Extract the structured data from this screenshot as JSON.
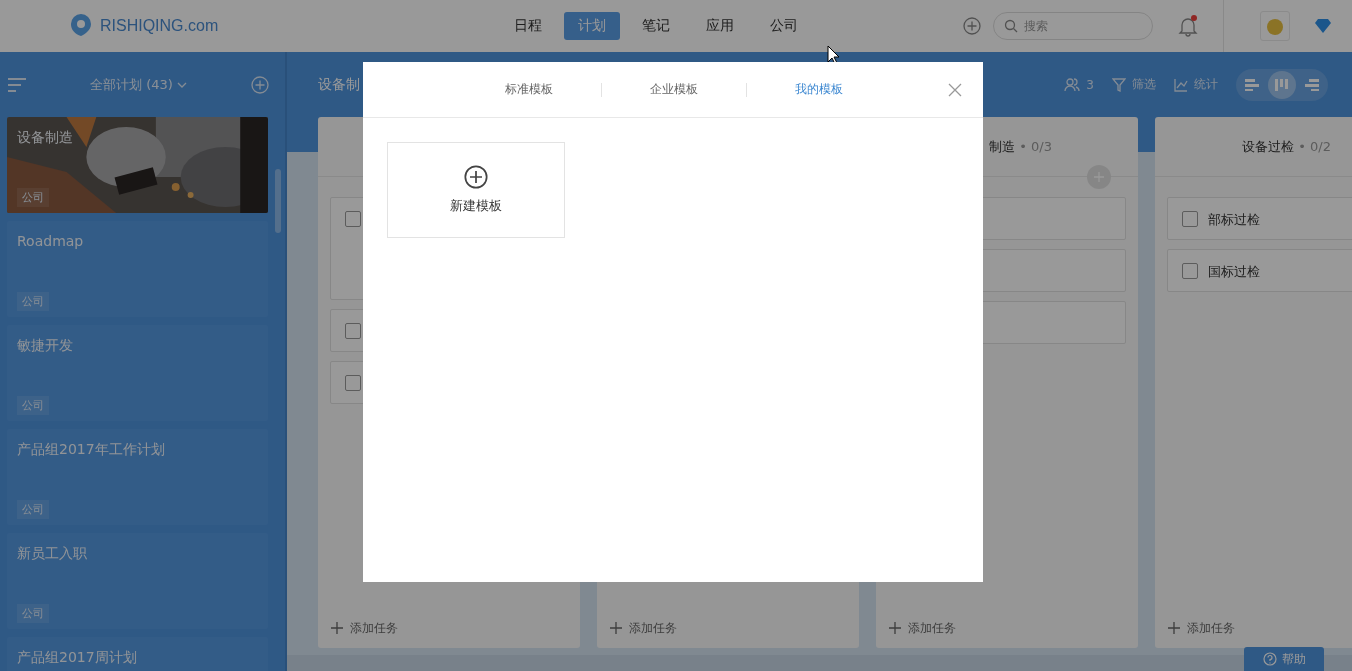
{
  "header": {
    "logo": "RISHIQING.com",
    "nav": [
      {
        "label": "日程",
        "selected": false
      },
      {
        "label": "计划",
        "selected": true
      },
      {
        "label": "笔记",
        "selected": false
      },
      {
        "label": "应用",
        "selected": false
      },
      {
        "label": "公司",
        "selected": false
      }
    ],
    "search": {
      "placeholder": "搜索"
    },
    "notifications": {
      "unread": true
    }
  },
  "sidebar": {
    "title": "全部计划 (43)",
    "plans": [
      {
        "kind": "picture",
        "title": "设备制造",
        "tag": "公司"
      },
      {
        "kind": "plain",
        "title": "Roadmap",
        "tag": "公司"
      },
      {
        "kind": "plain",
        "title": "敏捷开发",
        "tag": "公司"
      },
      {
        "kind": "plain",
        "title": "产品组2017年工作计划",
        "tag": "公司"
      },
      {
        "kind": "plain",
        "title": "新员工入职",
        "tag": "公司"
      },
      {
        "kind": "plain",
        "title": "产品组2017周计划"
      }
    ]
  },
  "board": {
    "title": "设备制",
    "members": "3",
    "filter": "筛选",
    "stats": "统计",
    "views": [
      {
        "kind": "gantt",
        "selected": false
      },
      {
        "kind": "board",
        "selected": true
      },
      {
        "kind": "list",
        "selected": false
      }
    ],
    "columns": [
      {
        "cards": [
          {
            "kind": "task",
            "checked": false
          },
          {
            "kind": "task",
            "checked": false
          },
          {
            "kind": "task",
            "checked": false
          }
        ],
        "add": "添加任务"
      },
      {
        "add": "添加任务"
      },
      {
        "title": "制造",
        "count": "• 0/3",
        "cards": [
          {
            "kind": "blank"
          },
          {
            "kind": "blank"
          },
          {
            "kind": "blank"
          }
        ],
        "add": "添加任务"
      },
      {
        "title": "设备过检",
        "count": "• 0/2",
        "cards": [
          {
            "kind": "task",
            "label": "部标过检",
            "checked": false
          },
          {
            "kind": "task",
            "label": "国标过检",
            "checked": false
          }
        ],
        "add": "添加任务"
      }
    ]
  },
  "help": "帮助",
  "modal": {
    "tabs": [
      {
        "label": "标准模板",
        "selected": false
      },
      {
        "label": "企业模板",
        "selected": false
      },
      {
        "label": "我的模板",
        "selected": true
      }
    ],
    "new_template": "新建模板"
  }
}
